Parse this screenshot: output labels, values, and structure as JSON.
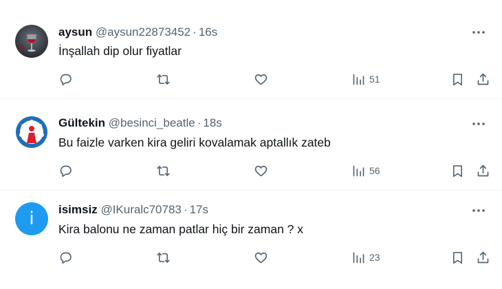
{
  "tweets": [
    {
      "name": "aysun",
      "handle": "@aysun22873452",
      "separator": "·",
      "time": "16s",
      "text": "İnşallah dip olur fiyatlar",
      "views": "51",
      "avatar": "wine-glass-photo"
    },
    {
      "name": "Gültekin",
      "handle": "@besinci_beatle",
      "separator": "·",
      "time": "18s",
      "text": "Bu faizle varken kira geliri kovalamak aptallık zateb",
      "views": "56",
      "avatar": "blue-circle-pattern-logo"
    },
    {
      "name": "isimsiz",
      "handle": "@IKuralc70783",
      "separator": "·",
      "time": "17s",
      "text": "Kira balonu ne zaman patlar hiç bir zaman ? x",
      "views": "23",
      "avatar": "info-letter-i",
      "avatar_letter": "i"
    }
  ],
  "colors": {
    "text": "#0f1419",
    "secondary": "#536471",
    "divider": "#eff3f4",
    "avatar_blue": "#1d9bf0"
  },
  "icons": [
    "reply-icon",
    "retweet-icon",
    "like-icon",
    "views-icon",
    "bookmark-icon",
    "share-icon",
    "more-icon"
  ]
}
